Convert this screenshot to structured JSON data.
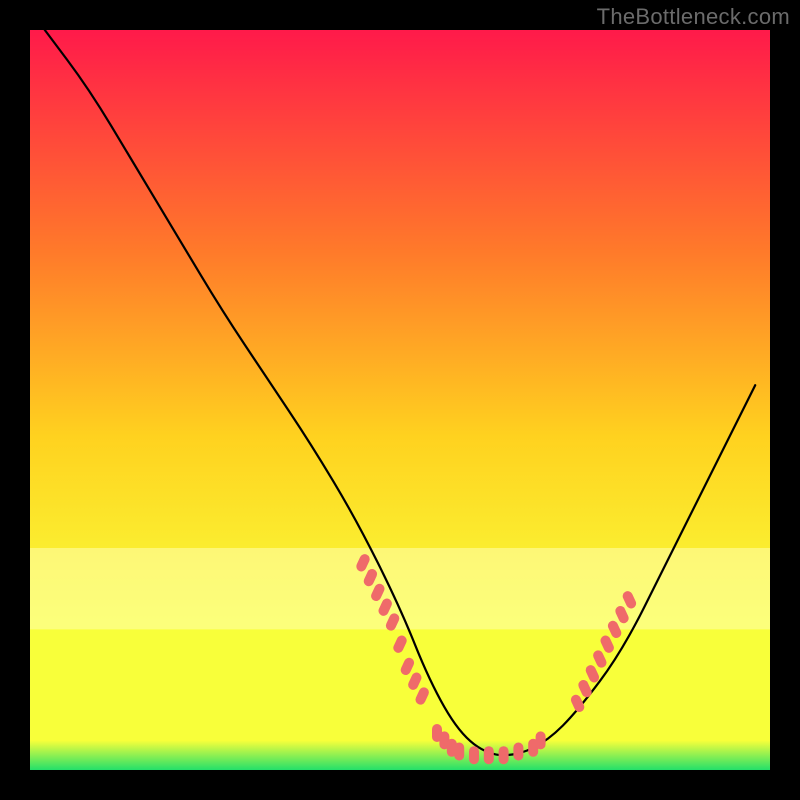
{
  "watermark": "TheBottleneck.com",
  "palette": {
    "background": "#000000",
    "gradient_top": "#ff1a4a",
    "gradient_mid_upper": "#ff7a2a",
    "gradient_mid": "#ffd21f",
    "gradient_mid_lower": "#f8ff3a",
    "gradient_green": "#23e06a",
    "curve": "#000000",
    "dots": "#ef6a6a"
  },
  "chart_data": {
    "type": "line",
    "title": "",
    "xlabel": "",
    "ylabel": "",
    "xlim": [
      0,
      100
    ],
    "ylim": [
      0,
      100
    ],
    "grid": false,
    "legend": false,
    "series": [
      {
        "name": "bottleneck-curve",
        "x": [
          2,
          8,
          14,
          20,
          26,
          32,
          38,
          44,
          50,
          54,
          58,
          62,
          66,
          70,
          74,
          80,
          86,
          92,
          98
        ],
        "y": [
          100,
          92,
          82,
          72,
          62,
          53,
          44,
          34,
          22,
          12,
          5,
          2,
          2,
          4,
          8,
          16,
          28,
          40,
          52
        ]
      }
    ],
    "dot_clusters": [
      {
        "name": "left-cluster",
        "points": [
          [
            45,
            28
          ],
          [
            46,
            26
          ],
          [
            47,
            24
          ],
          [
            48,
            22
          ],
          [
            49,
            20
          ],
          [
            50,
            17
          ],
          [
            51,
            14
          ],
          [
            52,
            12
          ],
          [
            53,
            10
          ]
        ]
      },
      {
        "name": "bottom-cluster",
        "points": [
          [
            55,
            5
          ],
          [
            56,
            4
          ],
          [
            57,
            3
          ],
          [
            58,
            2.5
          ],
          [
            60,
            2
          ],
          [
            62,
            2
          ],
          [
            64,
            2
          ],
          [
            66,
            2.5
          ],
          [
            68,
            3
          ],
          [
            69,
            4
          ]
        ]
      },
      {
        "name": "right-cluster",
        "points": [
          [
            74,
            9
          ],
          [
            75,
            11
          ],
          [
            76,
            13
          ],
          [
            77,
            15
          ],
          [
            78,
            17
          ],
          [
            79,
            19
          ],
          [
            80,
            21
          ],
          [
            81,
            23
          ]
        ]
      }
    ]
  }
}
